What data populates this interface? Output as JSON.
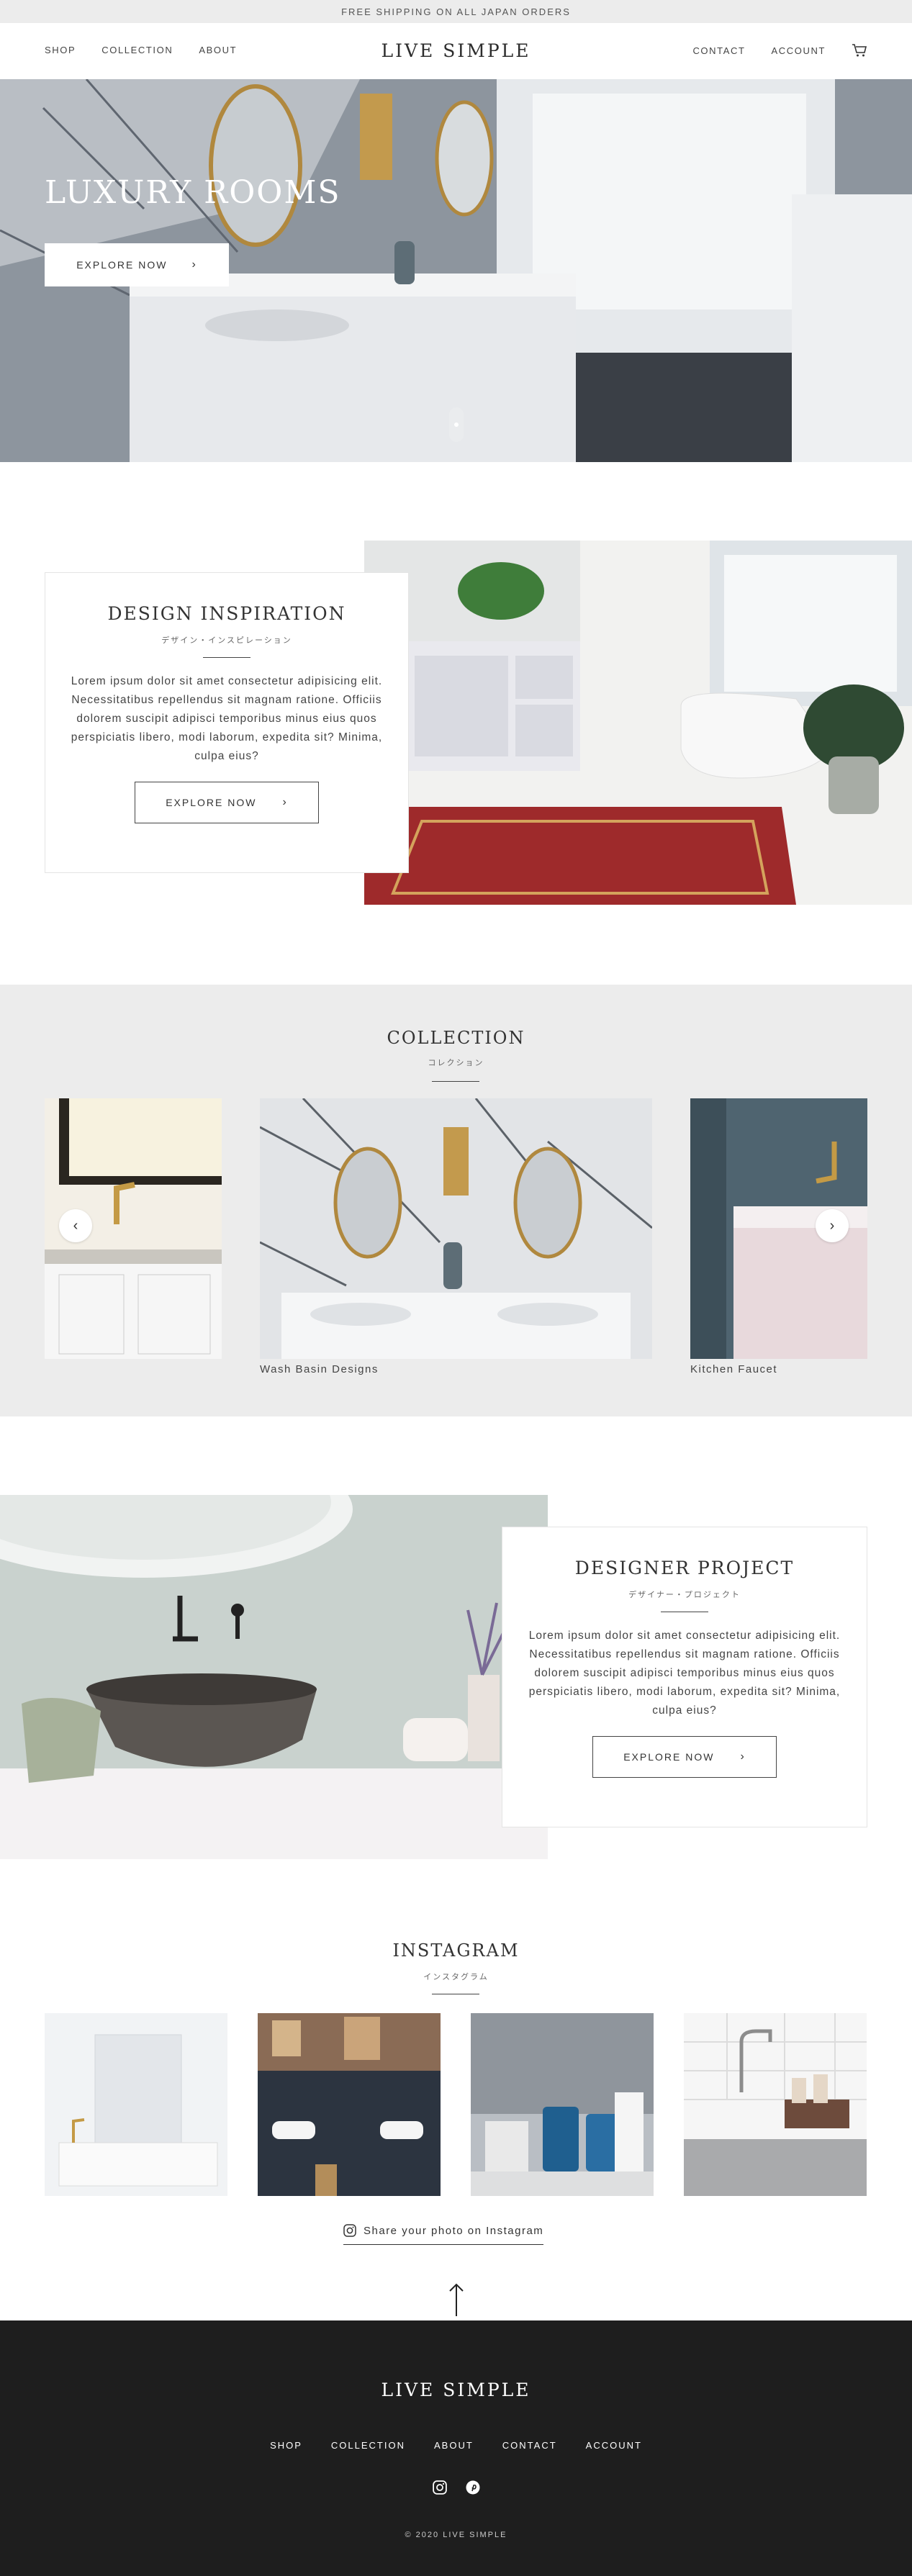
{
  "announcement": "FREE SHIPPING ON ALL JAPAN ORDERS",
  "header": {
    "logo": "LIVE SIMPLE",
    "nav_left": [
      "SHOP",
      "COLLECTION",
      "ABOUT"
    ],
    "nav_right": [
      "CONTACT",
      "ACCOUNT"
    ],
    "cart_icon": "cart-icon"
  },
  "hero": {
    "title": "LUXURY ROOMS",
    "button_label": "EXPLORE NOW",
    "slide_indicator": "1"
  },
  "design_inspiration": {
    "title": "DESIGN INSPIRATION",
    "subtitle": "デザイン・インスピレーション",
    "body": "Lorem ipsum dolor sit amet consectetur adipisicing elit. Necessitatibus repellendus sit magnam ratione. Officiis dolorem suscipit adipisci temporibus minus eius quos perspiciatis libero, modi laborum, expedita sit? Minima, culpa eius?",
    "button_label": "EXPLORE NOW"
  },
  "collection": {
    "title": "COLLECTION",
    "subtitle": "コレクション",
    "items": [
      {
        "label": ""
      },
      {
        "label": "Wash Basin Designs"
      },
      {
        "label": "Kitchen Faucet"
      }
    ],
    "prev_icon": "chevron-left-icon",
    "next_icon": "chevron-right-icon"
  },
  "designer_project": {
    "title": "DESIGNER PROJECT",
    "subtitle": "デザイナー・プロジェクト",
    "body": "Lorem ipsum dolor sit amet consectetur adipisicing elit. Necessitatibus repellendus sit magnam ratione. Officiis dolorem suscipit adipisci temporibus minus eius quos perspiciatis libero, modi laborum, expedita sit? Minima, culpa eius?",
    "button_label": "EXPLORE NOW"
  },
  "instagram": {
    "title": "INSTAGRAM",
    "subtitle": "インスタグラム",
    "share_label": "Share your photo on Instagram"
  },
  "footer": {
    "logo": "LIVE SIMPLE",
    "nav": [
      "SHOP",
      "COLLECTION",
      "ABOUT",
      "CONTACT",
      "ACCOUNT"
    ],
    "social": [
      "instagram-icon",
      "pinterest-icon"
    ],
    "copyright": "© 2020 LIVE SIMPLE"
  }
}
